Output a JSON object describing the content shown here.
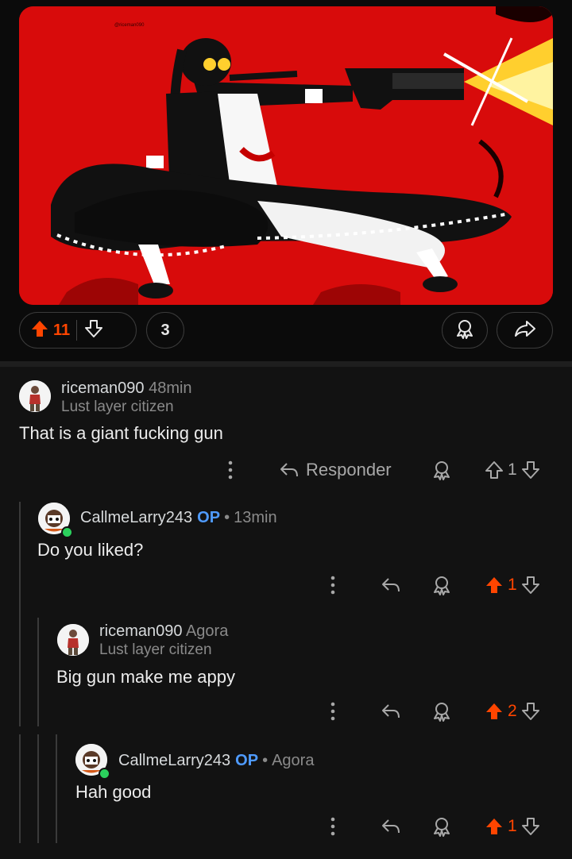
{
  "post": {
    "upvotes": "11",
    "comments_count": "3",
    "colors": {
      "accent": "#ff4500",
      "op": "#4f9bff",
      "online": "#2bd15d",
      "image_bg": "#d80b0b"
    }
  },
  "comments": [
    {
      "author": "riceman090",
      "time": "48min",
      "flair": "Lust layer citizen",
      "body": "That is a giant fucking gun",
      "reply_label": "Responder",
      "score": "1"
    },
    {
      "author": "CallmeLarry243",
      "op_badge": "OP",
      "separator": "•",
      "time": "13min",
      "body": "Do you liked?",
      "score": "1"
    },
    {
      "author": "riceman090",
      "time": "Agora",
      "flair": "Lust layer citizen",
      "body": "Big gun make me appy",
      "score": "2"
    },
    {
      "author": "CallmeLarry243",
      "op_badge": "OP",
      "separator": "•",
      "time": "Agora",
      "body": "Hah good",
      "score": "1"
    }
  ]
}
